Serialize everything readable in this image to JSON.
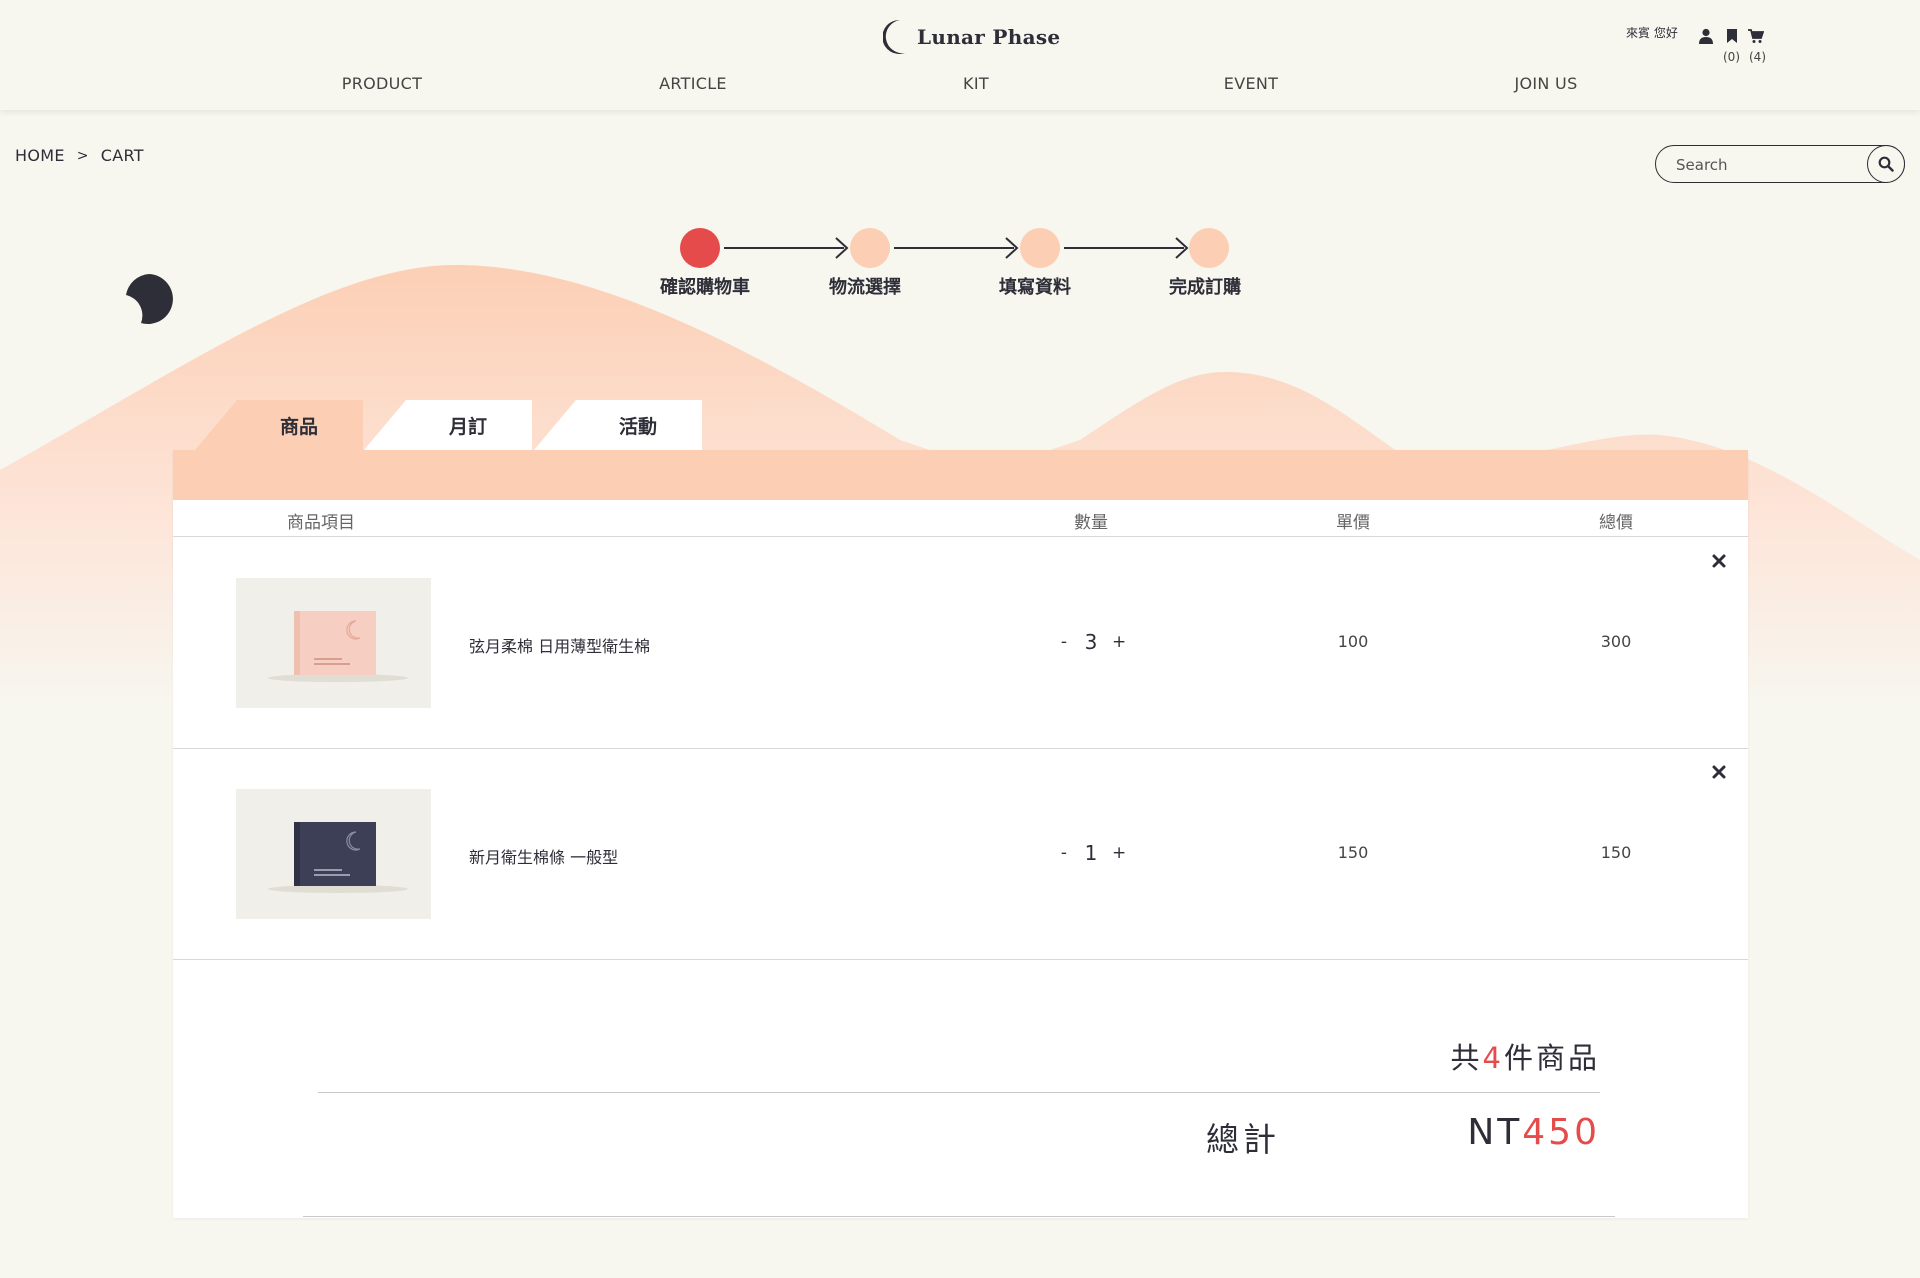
{
  "brand": {
    "name": "Lunar Phase"
  },
  "nav": [
    "PRODUCT",
    "ARTICLE",
    "KIT",
    "EVENT",
    "JOIN US"
  ],
  "user": {
    "greeting": "來賓 您好",
    "bookmark_count": "(0)",
    "cart_count": "(4)"
  },
  "breadcrumb": {
    "home": "HOME",
    "separator": ">",
    "current": "CART"
  },
  "search": {
    "placeholder": "Search"
  },
  "steps": [
    {
      "label": "確認購物車",
      "active": true
    },
    {
      "label": "物流選擇",
      "active": false
    },
    {
      "label": "填寫資料",
      "active": false
    },
    {
      "label": "完成訂購",
      "active": false
    }
  ],
  "tabs": [
    {
      "label": "商品",
      "active": true
    },
    {
      "label": "月訂",
      "active": false
    },
    {
      "label": "活動",
      "active": false
    }
  ],
  "columns": {
    "item": "商品項目",
    "qty": "數量",
    "unit_price": "單價",
    "total": "總價"
  },
  "items": [
    {
      "name": "弦月柔棉 日用薄型衛生棉",
      "qty": "3",
      "unit_price": "100",
      "total": "300",
      "box_color": "#f6cfc2"
    },
    {
      "name": "新月衛生棉條 一般型",
      "qty": "1",
      "unit_price": "150",
      "total": "150",
      "box_color": "#3c3f55"
    }
  ],
  "qty_controls": {
    "minus": "-",
    "plus": "+"
  },
  "summary": {
    "count_prefix": "共",
    "count": "4",
    "count_suffix": "件商品",
    "total_label": "總計",
    "currency": "NT",
    "total": "450"
  },
  "colors": {
    "background": "#f7f6ef",
    "peach": "#fccfb5",
    "accent_red": "#e64b4b",
    "dark": "#2e2e38"
  },
  "icons": [
    "user-icon",
    "bookmark-icon",
    "cart-icon",
    "search-icon",
    "close-icon",
    "moon-icon"
  ]
}
